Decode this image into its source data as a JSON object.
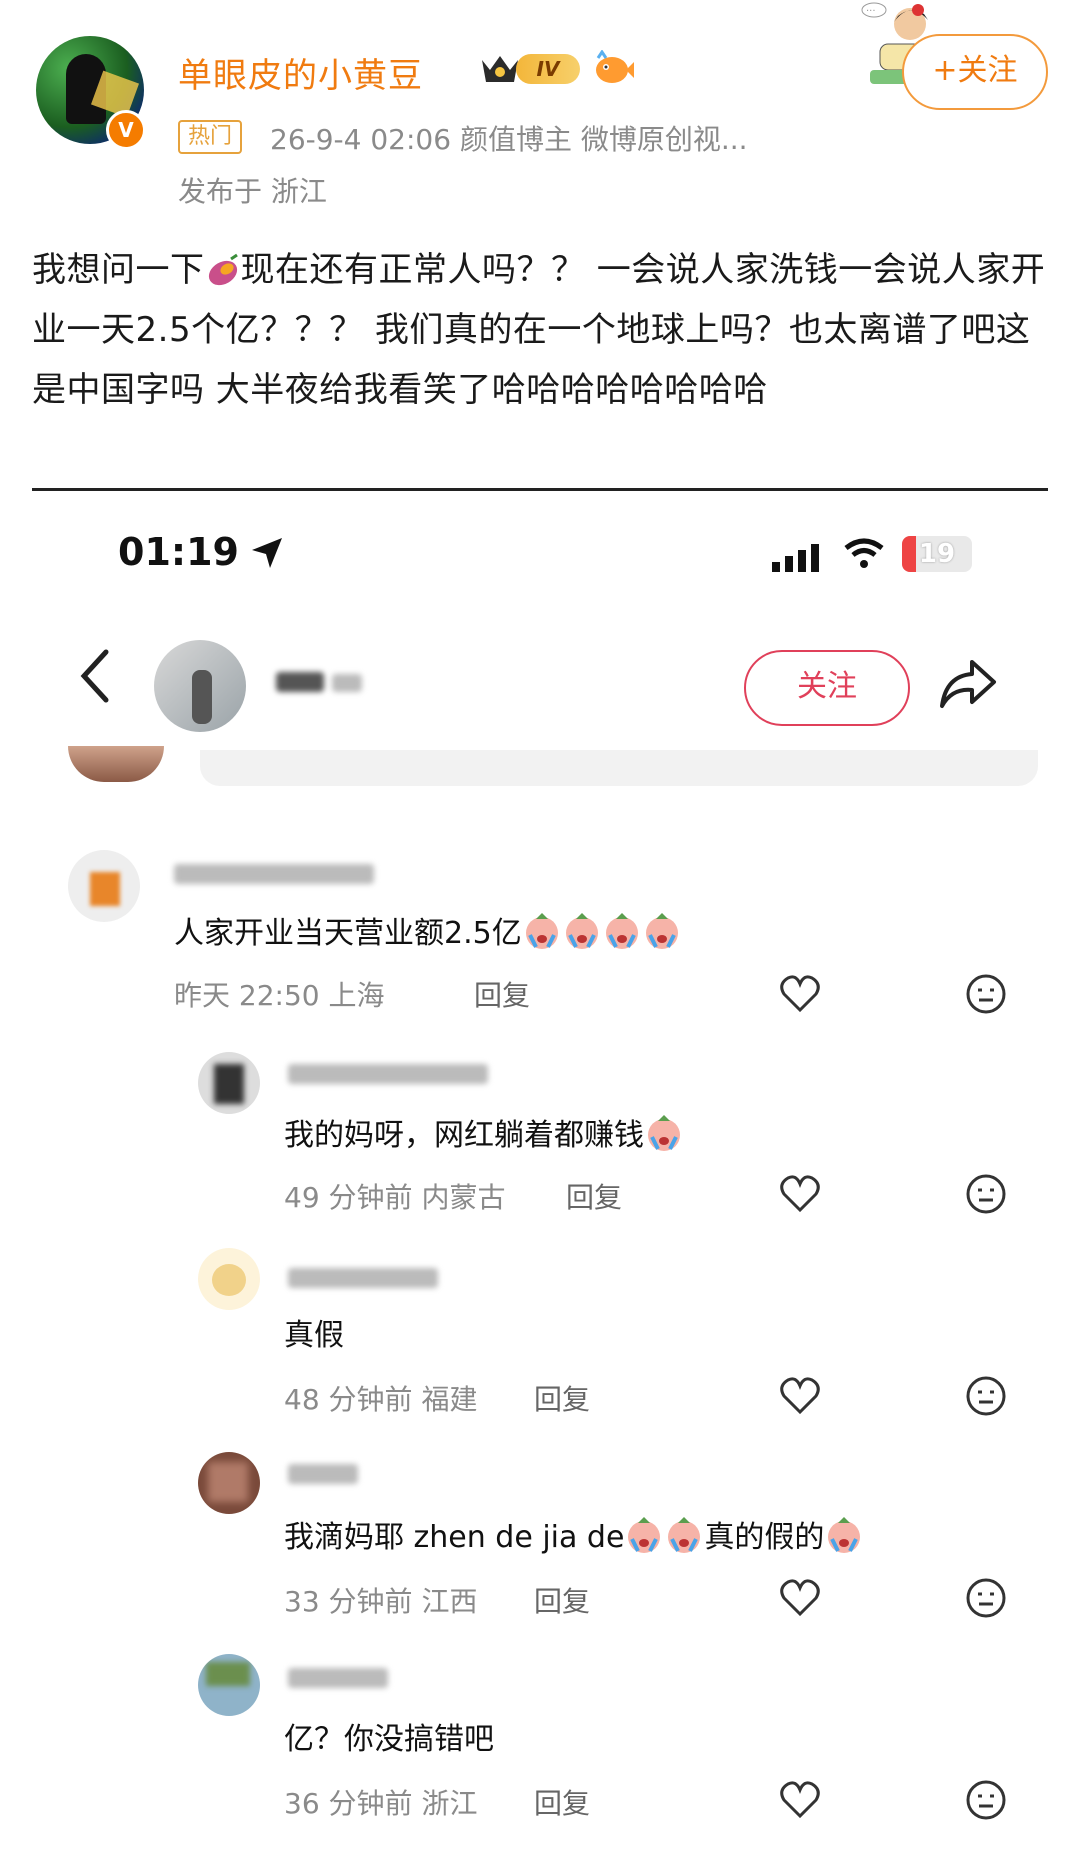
{
  "post": {
    "username": "单眼皮的小黄豆",
    "level_badge": "IV",
    "hot_tag": "热门",
    "meta": "26-9-4 02:06  颜值博主 微博原创视...",
    "location": "发布于 浙江",
    "follow_label": "+关注",
    "text_part1": "我想问一下",
    "text_part2": "现在还有正常人吗？？ 一会说人家洗钱一会说人家开业一天2.5个亿？？？ 我们真的在一个地球上吗？也太离谱了吧这是中国字吗 大半夜给我看笑了哈哈哈哈哈哈哈哈",
    "colors": {
      "accent": "#f07b10",
      "meta": "#8a8a8a"
    }
  },
  "screenshot": {
    "status_time": "01:19",
    "battery": "19",
    "follow_label": "关注",
    "comments": [
      {
        "text": "人家开业当天营业额2.5亿",
        "emoji_count": 4,
        "time": "昨天 22:50",
        "region": "上海",
        "reply": "回复"
      },
      {
        "text": "我的妈呀，网红躺着都赚钱",
        "emoji_count": 1,
        "time": "49 分钟前",
        "region": "内蒙古",
        "reply": "回复"
      },
      {
        "text": "真假",
        "emoji_count": 0,
        "time": "48 分钟前",
        "region": "福建",
        "reply": "回复"
      },
      {
        "text_a": "我滴妈耶 zhen de jia de",
        "text_b": "真的假的",
        "time": "33 分钟前",
        "region": "江西",
        "reply": "回复"
      },
      {
        "text": "亿？你没搞错吧",
        "emoji_count": 0,
        "time": "36 分钟前",
        "region": "浙江",
        "reply": "回复"
      }
    ]
  }
}
